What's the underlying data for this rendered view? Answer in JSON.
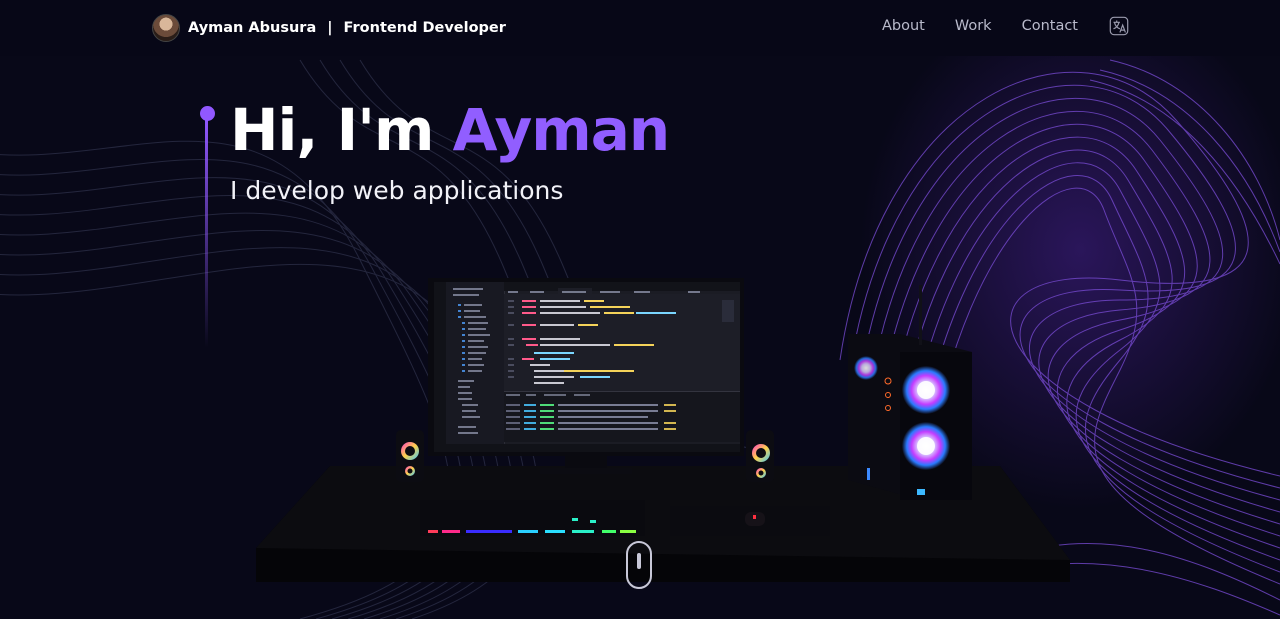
{
  "nav": {
    "name": "Ayman Abusura",
    "separator": "|",
    "role": "Frontend Developer",
    "links": [
      "About",
      "Work",
      "Contact"
    ],
    "language_icon": "language-globe-icon"
  },
  "hero": {
    "greeting": "Hi, I'm ",
    "name": "Ayman",
    "subtitle": "I develop web applications"
  },
  "colors": {
    "background": "#080818",
    "accent": "#915eff",
    "nav_text": "#b9bacb"
  },
  "scene": {
    "description_icons": [
      "desk",
      "monitor",
      "keyboard",
      "speaker",
      "pc-case",
      "rgb-fan"
    ]
  },
  "scroll_icon": "mouse-scroll-icon"
}
